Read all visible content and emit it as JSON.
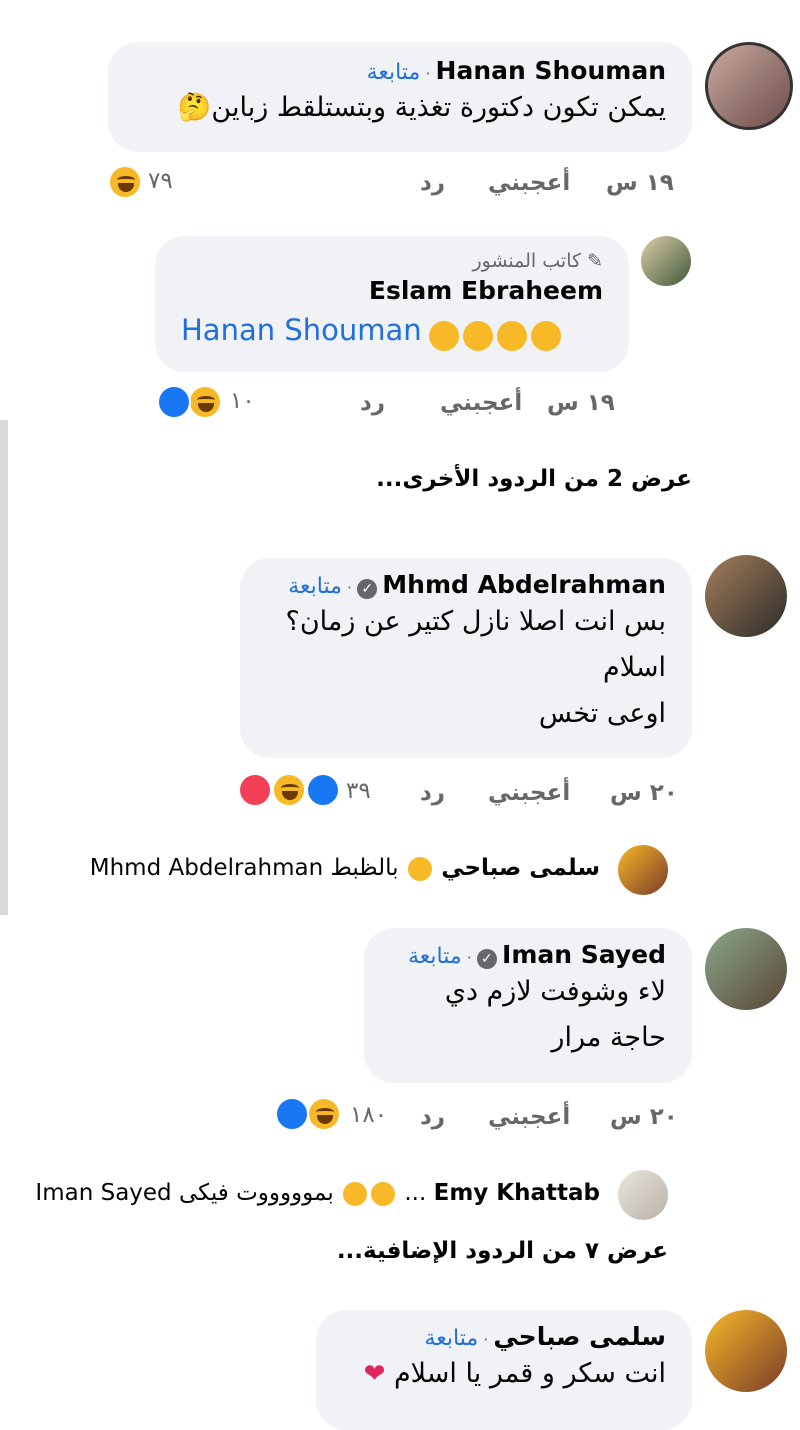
{
  "comments": [
    {
      "name": "Hanan Shouman",
      "follow": "متابعة",
      "text": "يمكن تكون دكتورة تغذية وبتستلقط زباين🤔",
      "time": "١٩ س",
      "like": "أعجبني",
      "reply": "رد",
      "count": "٧٩"
    },
    {
      "author_badge": "كاتب المنشور",
      "name": "Eslam Ebraheem",
      "mention": "Hanan Shouman",
      "time": "١٩ س",
      "like": "أعجبني",
      "reply": "رد",
      "count": "١٠"
    },
    {
      "view_more": "عرض 2 من الردود الأخرى..."
    },
    {
      "name": "Mhmd Abdelrahman",
      "follow": "متابعة",
      "lines": [
        "بس انت اصلا نازل كتير عن زمان؟",
        "اسلام",
        "اوعى تخس"
      ],
      "time": "٢٠ س",
      "like": "أعجبني",
      "reply": "رد",
      "count": "٣٩"
    },
    {
      "reply_name": "سلمى صباحي",
      "reply_text": "بالظبط",
      "reply_mention": "Mhmd Abdelrahman"
    },
    {
      "name": "Iman Sayed",
      "follow": "متابعة",
      "lines": [
        "لاء وشوفت لازم دي",
        "حاجة مرار"
      ],
      "time": "٢٠ س",
      "like": "أعجبني",
      "reply": "رد",
      "count": "١٨٠"
    },
    {
      "reply_name": "Emy Khattab",
      "reply_text": "بموووووت فيكى",
      "reply_mention": "Iman Sayed"
    },
    {
      "view_more": "عرض ٧ من الردود الإضافية..."
    },
    {
      "name": "سلمى صباحي",
      "follow": "متابعة",
      "text": "انت سكر و قمر يا اسلام"
    }
  ],
  "colors": {
    "follow": "#216fdb",
    "bubble": "#f0f2f5",
    "meta": "#65676b"
  }
}
